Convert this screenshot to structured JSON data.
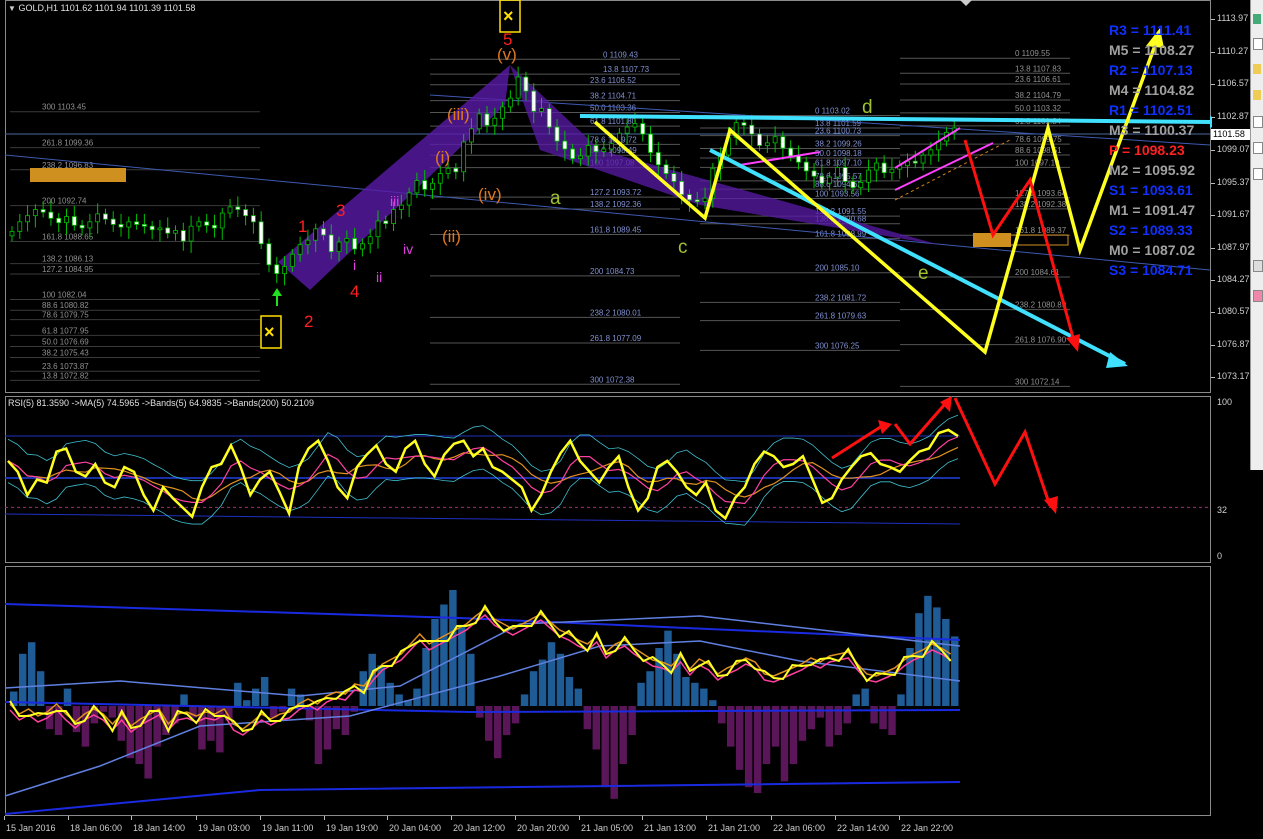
{
  "window": {
    "header": "GOLD,H1  1101.62 1101.94 1101.39 1101.58",
    "symbol_icon": "dropdown-triangle-icon"
  },
  "price_axis": {
    "labels": [
      "1113.97",
      "1110.27",
      "1106.57",
      "1102.87",
      "1099.07",
      "1095.37",
      "1091.67",
      "1087.97",
      "1084.27",
      "1080.57",
      "1076.87",
      "1073.17"
    ],
    "current_price": "1101.58"
  },
  "rsi_panel": {
    "header": "RSI(5) 81.3590  ->MA(5) 74.5965  ->Bands(5) 64.9835  ->Bands(200) 50.2109",
    "axis_labels": [
      "100",
      "32",
      "0"
    ]
  },
  "time_axis": [
    "15 Jan 2016",
    "18 Jan 06:00",
    "18 Jan 14:00",
    "19 Jan 03:00",
    "19 Jan 11:00",
    "19 Jan 19:00",
    "20 Jan 04:00",
    "20 Jan 12:00",
    "20 Jan 20:00",
    "21 Jan 05:00",
    "21 Jan 13:00",
    "21 Jan 21:00",
    "22 Jan 06:00",
    "22 Jan 14:00",
    "22 Jan 22:00"
  ],
  "pivots": [
    {
      "label": "R3 = 1111.41",
      "color": "#1030ff"
    },
    {
      "label": "M5 = 1108.27",
      "color": "#a0a0a0"
    },
    {
      "label": "R2 = 1107.13",
      "color": "#1030ff"
    },
    {
      "label": "M4 = 1104.82",
      "color": "#a0a0a0"
    },
    {
      "label": "R1 = 1102.51",
      "color": "#1030ff"
    },
    {
      "label": "M3 = 1100.37",
      "color": "#a0a0a0"
    },
    {
      "label": "P = 1098.23",
      "color": "#ff2020"
    },
    {
      "label": "M2 = 1095.92",
      "color": "#a0a0a0"
    },
    {
      "label": "S1 = 1093.61",
      "color": "#1030ff"
    },
    {
      "label": "M1 = 1091.47",
      "color": "#a0a0a0"
    },
    {
      "label": "S2 = 1089.33",
      "color": "#1030ff"
    },
    {
      "label": "M0 = 1087.02",
      "color": "#a0a0a0"
    },
    {
      "label": "S3 = 1084.71",
      "color": "#1030ff"
    }
  ],
  "wave_labels": {
    "red": [
      "1",
      "2",
      "3",
      "4",
      "5"
    ],
    "magenta": [
      "i",
      "ii",
      "iii",
      "iv"
    ],
    "orange": [
      "(i)",
      "(ii)",
      "(iii)",
      "(iv)",
      "(v)"
    ],
    "green": [
      "a",
      "c",
      "d",
      "e"
    ]
  },
  "fib_left": [
    "300 1103.45",
    "261.8 1099.36",
    "238.2 1096.83",
    "200 1092.74",
    "161.8 1088.65",
    "138.2 1086.13",
    "127.2 1084.95",
    "100 1082.04",
    "88.6 1080.82",
    "78.6 1079.75",
    "61.8 1077.95",
    "50.0 1076.69",
    "38.2 1075.43",
    "23.6 1073.87",
    "13.8 1072.82"
  ],
  "fib_mid": [
    "0 1109.43",
    "13.8 1107.73",
    "23.6 1106.52",
    "38.2 1104.71",
    "50.0 1103.36",
    "61.8 1101.80",
    "78.6 1099.72",
    "88.6 1098.49",
    "100 1097.08",
    "127.2 1093.72",
    "138.2 1092.36",
    "161.8 1089.45",
    "200 1084.73",
    "238.2 1080.01",
    "261.8 1077.09",
    "300 1072.38"
  ],
  "fib_mid2": [
    "0 1103.02",
    "13.8 1101.59",
    "23.6 1100.73",
    "38.2 1099.26",
    "50.0 1098.18",
    "61.8 1097.10",
    "78.6 1095.57",
    "88.6 1094.62",
    "100 1093.56",
    "127.2 1091.55",
    "138.2 1090.68",
    "161.8 1088.99",
    "200 1085.10",
    "238.2 1081.72",
    "261.8 1079.63",
    "300 1076.25"
  ],
  "fib_right": [
    "0 1109.55",
    "13.8 1107.83",
    "23.6 1106.61",
    "38.2 1104.79",
    "50.0 1103.32",
    "61.8 1101.84",
    "78.6 1099.75",
    "88.6 1098.51",
    "100 1097.10",
    "127.2 1093.64",
    "138.2 1092.38",
    "161.8 1089.37",
    "200 1084.61",
    "238.2 1080.89",
    "261.8 1076.90",
    "300 1072.14"
  ],
  "chart_data": {
    "type": "candlestick",
    "symbol": "GOLD",
    "timeframe": "H1",
    "ohlc_last": {
      "open": 1101.62,
      "high": 1101.94,
      "low": 1101.39,
      "close": 1101.58
    },
    "ylim": [
      1071.5,
      1115.5
    ],
    "x_ticks": [
      "15 Jan 2016",
      "18 Jan 06:00",
      "18 Jan 14:00",
      "19 Jan 03:00",
      "19 Jan 11:00",
      "19 Jan 19:00",
      "20 Jan 04:00",
      "20 Jan 12:00",
      "20 Jan 20:00",
      "21 Jan 05:00",
      "21 Jan 13:00",
      "21 Jan 21:00",
      "22 Jan 06:00",
      "22 Jan 14:00",
      "22 Jan 22:00"
    ],
    "closes": [
      1089.8,
      1090.9,
      1091.6,
      1092.3,
      1092.0,
      1091.3,
      1090.8,
      1091.5,
      1090.5,
      1090.2,
      1090.9,
      1091.8,
      1091.2,
      1090.6,
      1090.3,
      1090.9,
      1090.6,
      1090.4,
      1090.0,
      1090.2,
      1089.6,
      1089.9,
      1088.7,
      1090.4,
      1090.9,
      1090.5,
      1090.2,
      1091.9,
      1092.6,
      1092.3,
      1091.6,
      1090.9,
      1088.4,
      1086.0,
      1085.0,
      1085.8,
      1087.2,
      1088.3,
      1088.8,
      1090.1,
      1089.4,
      1087.5,
      1088.6,
      1089.0,
      1087.8,
      1088.4,
      1089.2,
      1091.0,
      1090.7,
      1092.3,
      1092.8,
      1094.2,
      1095.6,
      1094.6,
      1095.3,
      1096.4,
      1097.0,
      1096.6,
      1100.0,
      1101.5,
      1103.2,
      1101.9,
      1102.7,
      1104.0,
      1105.0,
      1107.4,
      1105.8,
      1103.5,
      1103.8,
      1101.7,
      1100.1,
      1099.2,
      1098.1,
      1098.4,
      1099.6,
      1098.9,
      1099.2,
      1099.8,
      1101.0,
      1101.7,
      1102.1,
      1100.9,
      1098.8,
      1097.4,
      1096.4,
      1095.5,
      1094.0,
      1093.4,
      1093.2,
      1093.6,
      1097.0,
      1098.5,
      1100.5,
      1102.2,
      1101.9,
      1100.9,
      1099.6,
      1099.9,
      1100.6,
      1099.3,
      1098.4,
      1097.7,
      1096.7,
      1096.1,
      1095.3,
      1096.0,
      1097.1,
      1095.5,
      1094.8,
      1095.4,
      1096.8,
      1097.6,
      1096.5,
      1096.9,
      1097.3,
      1097.8,
      1097.6,
      1098.5,
      1099.1,
      1100.1,
      1101.1,
      1101.6
    ],
    "drawings": {
      "cyan_lines": [
        [
          [
            580,
            116
          ],
          [
            1210,
            122
          ]
        ],
        [
          [
            710,
            150
          ],
          [
            1125,
            364
          ]
        ]
      ],
      "yellow_zigzag": [
        [
          595,
          122
        ],
        [
          705,
          218
        ],
        [
          730,
          130
        ],
        [
          985,
          352
        ],
        [
          1048,
          128
        ],
        [
          1080,
          250
        ],
        [
          1157,
          40
        ]
      ],
      "red_zigzag": [
        [
          965,
          140
        ],
        [
          993,
          235
        ],
        [
          1030,
          180
        ],
        [
          1075,
          345
        ]
      ]
    }
  },
  "rsi_data": {
    "rsi": [
      62,
      55,
      40,
      50,
      48,
      68,
      70,
      55,
      52,
      60,
      48,
      45,
      58,
      55,
      40,
      30,
      45,
      38,
      32,
      26,
      45,
      58,
      60,
      72,
      58,
      40,
      50,
      55,
      42,
      28,
      58,
      70,
      75,
      62,
      45,
      38,
      58,
      66,
      72,
      60,
      55,
      70,
      75,
      60,
      52,
      66,
      73,
      75,
      65,
      70,
      58,
      55,
      50,
      45,
      30,
      40,
      55,
      67,
      75,
      62,
      55,
      48,
      58,
      65,
      45,
      30,
      38,
      58,
      62,
      55,
      45,
      40,
      48,
      30,
      25,
      38,
      45,
      60,
      68,
      65,
      58,
      60,
      65,
      50,
      35,
      38,
      50,
      58,
      65,
      67,
      60,
      58,
      55,
      62,
      68,
      70,
      80,
      82,
      78
    ],
    "forecast": [
      80,
      60,
      72,
      50,
      35
    ],
    "ylim": [
      0,
      100
    ]
  },
  "histogram_data": {
    "bars": [
      5,
      18,
      22,
      12,
      -8,
      -10,
      6,
      -9,
      -14,
      -6,
      -2,
      -4,
      -12,
      -18,
      -20,
      -25,
      -14,
      -10,
      -6,
      4,
      -4,
      -15,
      -12,
      -16,
      -5,
      8,
      2,
      6,
      10,
      -4,
      -2,
      6,
      4,
      -5,
      -20,
      -15,
      -8,
      -10,
      -2,
      12,
      18,
      14,
      8,
      4,
      2,
      6,
      20,
      30,
      35,
      40,
      28,
      18,
      -4,
      -12,
      -18,
      -10,
      -6,
      4,
      12,
      16,
      22,
      18,
      10,
      6,
      -8,
      -15,
      -28,
      -32,
      -20,
      -10,
      8,
      12,
      20,
      26,
      18,
      10,
      8,
      6,
      2,
      -6,
      -14,
      -22,
      -28,
      -30,
      -20,
      -14,
      -26,
      -20,
      -12,
      -8,
      -4,
      -14,
      -10,
      -6,
      4,
      6,
      -6,
      -8,
      -10,
      4,
      20,
      32,
      38,
      34,
      30,
      24
    ],
    "ylim": [
      -40,
      42
    ]
  }
}
